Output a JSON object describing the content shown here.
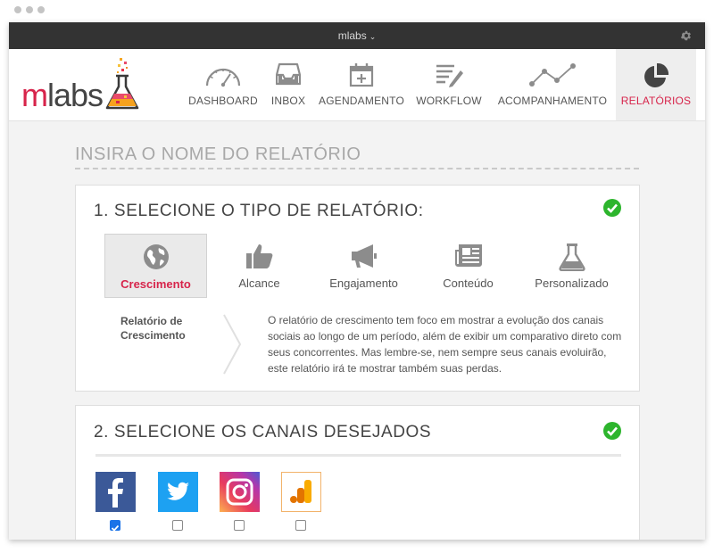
{
  "window": {
    "account": "mlabs"
  },
  "logo": {
    "m": "m",
    "rest": "labs"
  },
  "nav": [
    {
      "label": "DASHBOARD",
      "icon": "gauge-icon",
      "active": false
    },
    {
      "label": "INBOX",
      "icon": "inbox-icon",
      "active": false
    },
    {
      "label": "AGENDAMENTO",
      "icon": "calendar-add-icon",
      "active": false
    },
    {
      "label": "WORKFLOW",
      "icon": "workflow-list-icon",
      "active": false
    },
    {
      "label": "ACOMPANHAMENTO",
      "icon": "line-trend-icon",
      "active": false
    },
    {
      "label": "RELATÓRIOS",
      "icon": "pie-chart-icon",
      "active": true
    }
  ],
  "report_name": {
    "placeholder": "INSIRA O NOME DO RELATÓRIO"
  },
  "section1": {
    "title": "1. SELECIONE O TIPO DE RELATÓRIO:",
    "types": [
      {
        "label": "Crescimento",
        "icon": "globe-icon",
        "selected": true
      },
      {
        "label": "Alcance",
        "icon": "thumbs-up-icon",
        "selected": false
      },
      {
        "label": "Engajamento",
        "icon": "megaphone-icon",
        "selected": false
      },
      {
        "label": "Conteúdo",
        "icon": "newspaper-icon",
        "selected": false
      },
      {
        "label": "Personalizado",
        "icon": "flask-icon",
        "selected": false
      }
    ],
    "description_title": "Relatório de Crescimento",
    "description": "O relatório de crescimento tem foco em mostrar a evolução dos canais sociais ao longo de um período, além de exibir um comparativo direto com seus concorrentes. Mas lembre-se, nem sempre seus canais evoluirão, este relatório irá te mostrar também suas perdas."
  },
  "section2": {
    "title": "2. SELECIONE OS CANAIS DESEJADOS",
    "channels": [
      {
        "icon": "facebook-icon",
        "checked": true
      },
      {
        "icon": "twitter-icon",
        "checked": false
      },
      {
        "icon": "instagram-icon",
        "checked": false
      },
      {
        "icon": "google-analytics-icon",
        "checked": false
      }
    ]
  },
  "colors": {
    "accent": "#d7244b",
    "success": "#2db52d",
    "titlebar": "#333333",
    "facebook": "#3b5998",
    "twitter": "#1da1f2"
  }
}
